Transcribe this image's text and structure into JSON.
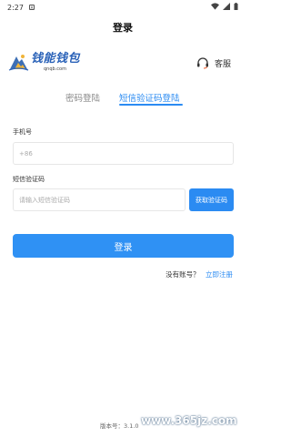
{
  "status": {
    "time": "2:27",
    "notif_icon": "a-badge-icon"
  },
  "header": {
    "title": "登录"
  },
  "logo": {
    "name": "钱能钱包",
    "domain": "qnqb.com"
  },
  "service": {
    "label": "客服",
    "icon": "headset-icon"
  },
  "tabs": [
    {
      "label": "密码登陆",
      "active": false
    },
    {
      "label": "短信验证码登陆",
      "active": true
    }
  ],
  "form": {
    "phone_label": "手机号",
    "phone_placeholder": "+86",
    "code_label": "短信验证码",
    "code_placeholder": "请输入短信验证码",
    "get_code_label": "获取验证码",
    "submit_label": "登录"
  },
  "register": {
    "question": "没有账号？",
    "link": "立即注册"
  },
  "version": {
    "label": "版本号：3.1.0"
  },
  "watermark": {
    "text": "www.365jz.com"
  },
  "colors": {
    "accent": "#2b8bf2",
    "logo": "#2a62b8"
  }
}
